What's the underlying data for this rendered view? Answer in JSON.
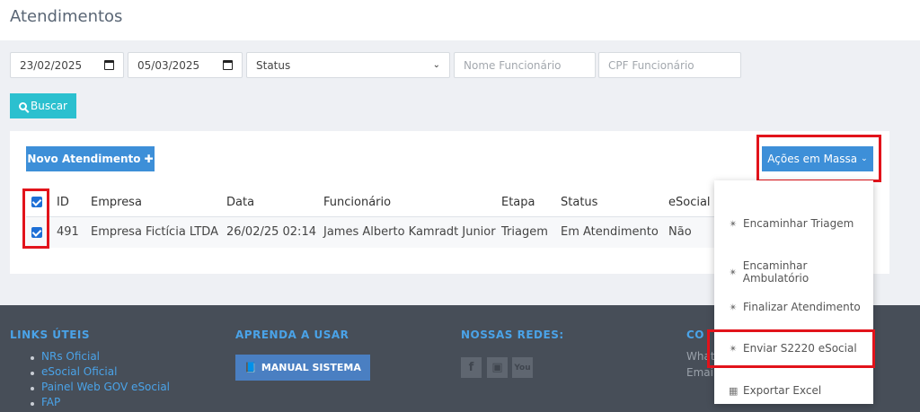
{
  "page": {
    "title": "Atendimentos"
  },
  "filters": {
    "date_start": "23/02/2025",
    "date_end": "05/03/2025",
    "status_value": "Status",
    "nome_placeholder": "Nome Funcionário",
    "cpf_placeholder": "CPF Funcionário",
    "search_label": "Buscar"
  },
  "toolbar": {
    "novo_label": "Novo Atendimento",
    "acoes_label": "Ações em Massa"
  },
  "table": {
    "headers": [
      "ID",
      "Empresa",
      "Data",
      "Funcionário",
      "Etapa",
      "Status",
      "eSocial"
    ],
    "rows": [
      {
        "id": "491",
        "empresa": "Empresa Fictícia LTDA",
        "data": "26/02/25 02:14",
        "funcionario": "James Alberto Kamradt Junior",
        "etapa": "Triagem",
        "status": "Em Atendimento",
        "esocial": "Não"
      }
    ]
  },
  "dropdown": {
    "items": [
      {
        "label": "Encaminhar Triagem",
        "icon": "stethoscope-icon"
      },
      {
        "label": "Encaminhar Ambulatório",
        "icon": "stethoscope-icon"
      },
      {
        "label": "Finalizar Atendimento",
        "icon": "stethoscope-icon"
      },
      {
        "label": "Enviar S2220 eSocial",
        "icon": "stethoscope-icon"
      },
      {
        "label": "Exportar Excel",
        "icon": "excel-file-icon"
      }
    ]
  },
  "footer": {
    "links_heading": "LINKS ÚTEIS",
    "links": [
      "NRs Oficial",
      "eSocial Oficial",
      "Painel Web GOV eSocial",
      "FAP"
    ],
    "learn_heading": "APRENDA A USAR",
    "manual_label": "MANUAL SISTEMA",
    "social_heading": "NOSSAS REDES:",
    "contact_heading_partial": "CO",
    "contact_line1_partial": "What",
    "contact_line2_partial": "Emai"
  },
  "colors": {
    "accent_blue": "#3d8fd8",
    "search_teal": "#2bc0cf",
    "highlight_red": "#e2131b",
    "footer_bg": "#474e58",
    "footer_heading": "#4aa3e8"
  }
}
